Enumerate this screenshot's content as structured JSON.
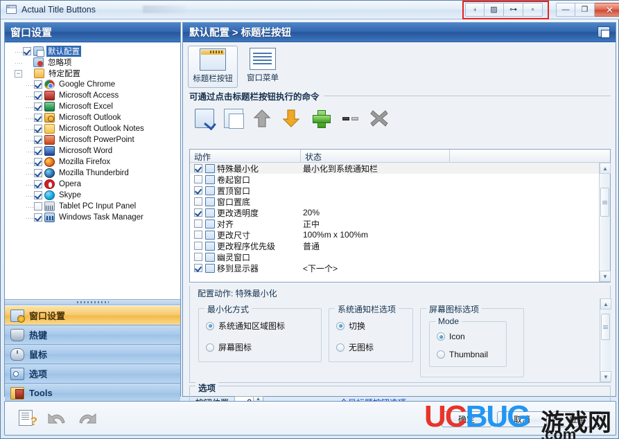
{
  "window": {
    "title": "Actual Title Buttons",
    "app_icon": "window-titlebar-icon",
    "extra_buttons": [
      {
        "name": "roll-up-button",
        "glyph": "⍖"
      },
      {
        "name": "transparency-button",
        "glyph": "▨"
      },
      {
        "name": "always-on-top-button",
        "glyph": "⊶"
      },
      {
        "name": "minimize-to-tray-button",
        "glyph": "▫"
      }
    ],
    "system_buttons": [
      {
        "name": "minimize-button",
        "glyph": "—"
      },
      {
        "name": "maximize-button",
        "glyph": "❐"
      },
      {
        "name": "close-button",
        "glyph": "✕"
      }
    ],
    "highlight_color": "#e8211b"
  },
  "left_panel": {
    "header": "窗口设置",
    "tree": [
      {
        "label": "默认配置",
        "icon": "config-window-icon",
        "checkbox": true,
        "checked": true,
        "selected": true,
        "indent": 1,
        "expander": null
      },
      {
        "label": "忽略项",
        "icon": "ignore-icon",
        "checkbox": false,
        "checked": false,
        "selected": false,
        "indent": 1,
        "expander": null
      },
      {
        "label": "特定配置",
        "icon": "folder-icon",
        "checkbox": false,
        "checked": false,
        "selected": false,
        "indent": 1,
        "expander": "minus"
      },
      {
        "label": "Google Chrome",
        "icon": "chrome-icon",
        "checkbox": true,
        "checked": true,
        "selected": false,
        "indent": 2,
        "expander": null
      },
      {
        "label": "Microsoft Access",
        "icon": "access-icon",
        "checkbox": true,
        "checked": true,
        "selected": false,
        "indent": 2,
        "expander": null
      },
      {
        "label": "Microsoft Excel",
        "icon": "excel-icon",
        "checkbox": true,
        "checked": true,
        "selected": false,
        "indent": 2,
        "expander": null
      },
      {
        "label": "Microsoft Outlook",
        "icon": "outlook-icon",
        "checkbox": true,
        "checked": true,
        "selected": false,
        "indent": 2,
        "expander": null
      },
      {
        "label": "Microsoft Outlook Notes",
        "icon": "outlook-notes-icon",
        "checkbox": true,
        "checked": true,
        "selected": false,
        "indent": 2,
        "expander": null
      },
      {
        "label": "Microsoft PowerPoint",
        "icon": "powerpoint-icon",
        "checkbox": true,
        "checked": true,
        "selected": false,
        "indent": 2,
        "expander": null
      },
      {
        "label": "Microsoft Word",
        "icon": "word-icon",
        "checkbox": true,
        "checked": true,
        "selected": false,
        "indent": 2,
        "expander": null
      },
      {
        "label": "Mozilla Firefox",
        "icon": "firefox-icon",
        "checkbox": true,
        "checked": true,
        "selected": false,
        "indent": 2,
        "expander": null
      },
      {
        "label": "Mozilla Thunderbird",
        "icon": "thunderbird-icon",
        "checkbox": true,
        "checked": true,
        "selected": false,
        "indent": 2,
        "expander": null
      },
      {
        "label": "Opera",
        "icon": "opera-icon",
        "checkbox": true,
        "checked": true,
        "selected": false,
        "indent": 2,
        "expander": null
      },
      {
        "label": "Skype",
        "icon": "skype-icon",
        "checkbox": true,
        "checked": true,
        "selected": false,
        "indent": 2,
        "expander": null
      },
      {
        "label": "Tablet PC Input Panel",
        "icon": "tablet-pc-input-panel-icon",
        "checkbox": true,
        "checked": false,
        "selected": false,
        "indent": 2,
        "expander": null
      },
      {
        "label": "Windows Task Manager",
        "icon": "task-manager-icon",
        "checkbox": true,
        "checked": true,
        "selected": false,
        "indent": 2,
        "expander": null
      }
    ],
    "nav": [
      {
        "label": "窗口设置",
        "icon": "window-settings-icon",
        "active": true
      },
      {
        "label": "热键",
        "icon": "hotkey-icon",
        "active": false
      },
      {
        "label": "鼠标",
        "icon": "mouse-icon",
        "active": false
      },
      {
        "label": "选项",
        "icon": "options-icon",
        "active": false
      },
      {
        "label": "Tools",
        "icon": "tools-icon",
        "active": false
      }
    ],
    "nav_more": "»"
  },
  "right_panel": {
    "header": "默认配置 > 标题栏按钮",
    "header_icon": "restore-window-icon",
    "tabs": [
      {
        "label": "标题栏按钮",
        "icon": "title-buttons-icon",
        "selected": true
      },
      {
        "label": "窗口菜单",
        "icon": "window-menu-icon",
        "selected": false
      }
    ],
    "commands_group_title": "可通过点击标题栏按钮执行的命令",
    "command_buttons": [
      {
        "name": "edit-action-button",
        "icon": "edit-checkbox-icon"
      },
      {
        "name": "copy-action-button",
        "icon": "copy-icon"
      },
      {
        "name": "move-up-button",
        "icon": "arrow-up-icon"
      },
      {
        "name": "move-down-button",
        "icon": "arrow-down-icon"
      },
      {
        "name": "add-action-button",
        "icon": "plus-icon"
      },
      {
        "name": "separator-button",
        "icon": "separator-icon"
      },
      {
        "name": "delete-action-button",
        "icon": "x-delete-icon"
      }
    ],
    "list": {
      "columns": [
        "动作",
        "状态"
      ],
      "rows": [
        {
          "checked": true,
          "icon": "minimize-special-icon",
          "action": "特殊最小化",
          "state": "最小化到系统通知栏",
          "selected": true
        },
        {
          "checked": false,
          "icon": "roll-up-icon",
          "action": "卷起窗口",
          "state": "",
          "selected": false
        },
        {
          "checked": true,
          "icon": "always-on-top-icon",
          "action": "置顶窗口",
          "state": "",
          "selected": false
        },
        {
          "checked": false,
          "icon": "send-to-bottom-icon",
          "action": "窗口置底",
          "state": "",
          "selected": false
        },
        {
          "checked": true,
          "icon": "transparency-icon",
          "action": "更改透明度",
          "state": "20%",
          "selected": false
        },
        {
          "checked": false,
          "icon": "align-icon",
          "action": "对齐",
          "state": "正中",
          "selected": false
        },
        {
          "checked": false,
          "icon": "resize-icon",
          "action": "更改尺寸",
          "state": "100%m x 100%m",
          "selected": false
        },
        {
          "checked": false,
          "icon": "priority-icon",
          "action": "更改程序优先级",
          "state": "普通",
          "selected": false
        },
        {
          "checked": false,
          "icon": "ghost-window-icon",
          "action": "幽灵窗口",
          "state": "",
          "selected": false
        },
        {
          "checked": true,
          "icon": "move-to-monitor-icon",
          "action": "移到显示器",
          "state": "<下一个>",
          "selected": false
        }
      ]
    },
    "config": {
      "title": "配置动作: 特殊最小化",
      "groups": [
        {
          "legend": "最小化方式",
          "name": "minimize-mode-group",
          "options": [
            {
              "label": "系统通知区域图标",
              "checked": true
            },
            {
              "label": "屏幕图标",
              "checked": false
            }
          ]
        },
        {
          "legend": "系统通知栏选项",
          "name": "tray-options-group",
          "options": [
            {
              "label": "切换",
              "checked": true
            },
            {
              "label": "无图标",
              "checked": false
            }
          ]
        },
        {
          "legend": "屏幕图标选项",
          "name": "screen-icon-options-group",
          "sub_legend": "Mode",
          "options": [
            {
              "label": "Icon",
              "checked": true
            },
            {
              "label": "Thumbnail",
              "checked": false
            }
          ]
        }
      ]
    },
    "options": {
      "title": "选项",
      "position_label": "按钮位置",
      "position_value": "0",
      "global_link": "全局标题按钮选项..."
    }
  },
  "bottom_bar": {
    "help_icon": "help-icon",
    "undo_icon": "undo-arrow-icon",
    "redo_icon": "redo-arrow-icon",
    "ok_label": "确定",
    "cancel_label": "取消",
    "apply_label": "应用"
  },
  "watermark": {
    "part1": "UC",
    "part2": "BUG",
    "part3": "游戏网",
    "domain": ".com"
  }
}
